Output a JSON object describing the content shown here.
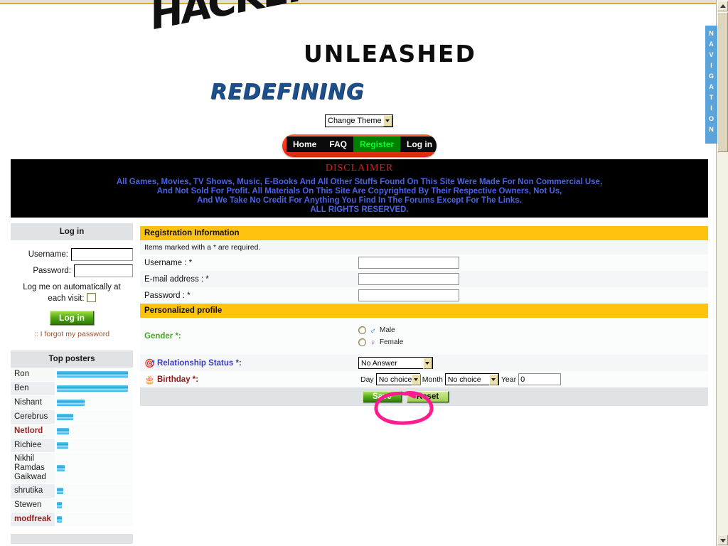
{
  "site": {
    "logo_line1": "HACKERS",
    "logo_line2": "UNLEASHED",
    "logo_line3": "REDEFINING",
    "nav_tab_label": "NAVIGATION"
  },
  "theme": {
    "selected": "Change Theme"
  },
  "mainnav": {
    "items": [
      {
        "label": "Home",
        "active": false
      },
      {
        "label": "FAQ",
        "active": false
      },
      {
        "label": "Register",
        "active": true
      },
      {
        "label": "Log in",
        "active": false
      }
    ]
  },
  "disclaimer": {
    "title": "DISCLAIMER",
    "line1": "All Games, Movies, TV Shows, Music, E-Books And All Other Stuffs Found On This Site Were Made For Non Commercial Use,",
    "line2": "And Not Sold For Profit. All Materials On This Site Are Copyrighted By Their Respective Owners, Not Us,",
    "line3": "And We Take No Credit For Anything You Find In The Forums Except For The Links.",
    "line4": "ALL RIGHTS RESERVED.",
    "title_color": "#d42020",
    "text_color": "#4a62e8"
  },
  "login_panel": {
    "title": "Log in",
    "username_label": "Username:",
    "username_value": "",
    "username_placeholder": "",
    "password_label": "Password:",
    "password_value": "",
    "password_placeholder": "",
    "auto_login_label": "Log me on automatically at each visit:",
    "auto_login_checked": false,
    "login_button": "Log in",
    "forgot_link": ":: I forgot my password"
  },
  "top_posters": {
    "title": "Top posters",
    "rows": [
      {
        "name": "Ron",
        "bar_pct": 100,
        "highlight": false
      },
      {
        "name": "Ben",
        "bar_pct": 100,
        "highlight": false
      },
      {
        "name": "Nishant",
        "bar_pct": 39,
        "highlight": false
      },
      {
        "name": "Cerebrus",
        "bar_pct": 23,
        "highlight": false
      },
      {
        "name": "Netlord",
        "bar_pct": 17,
        "highlight": true
      },
      {
        "name": "Richiee",
        "bar_pct": 16,
        "highlight": false
      },
      {
        "name": "Nikhil Ramdas Gaikwad",
        "bar_pct": 11,
        "highlight": false
      },
      {
        "name": "shrutika",
        "bar_pct": 9,
        "highlight": false
      },
      {
        "name": "Stewen",
        "bar_pct": 7,
        "highlight": false
      },
      {
        "name": "modfreak",
        "bar_pct": 7,
        "highlight": true
      }
    ]
  },
  "registration": {
    "section_title": "Registration Information",
    "required_note": "Items marked with a * are required.",
    "fields": [
      {
        "label": "Username : *",
        "value": "",
        "placeholder": ""
      },
      {
        "label": "E-mail address : *",
        "value": "",
        "placeholder": ""
      },
      {
        "label": "Password : *",
        "value": "",
        "placeholder": ""
      }
    ]
  },
  "profile": {
    "section_title": "Personalized profile",
    "gender": {
      "label": "Gender *:",
      "label_color": "#4ba32a",
      "options": [
        {
          "label": "Male",
          "symbol": "♂",
          "selected": false
        },
        {
          "label": "Female",
          "symbol": "♀",
          "selected": false
        }
      ]
    },
    "relationship": {
      "label": "Relationship Status *:",
      "label_color": "#3b3bbd",
      "icon": "target-icon",
      "selected": "No Answer"
    },
    "birthday": {
      "label": "Birthday *:",
      "label_color": "#8b1a1a",
      "icon": "cake-icon",
      "day_label": "Day",
      "day_value": "No choice",
      "month_label": "Month",
      "month_value": "No choice",
      "year_label": "Year",
      "year_value": "0"
    }
  },
  "form_buttons": {
    "save": "Save",
    "reset": "Reset"
  },
  "annotation": {
    "shape": "hand-drawn-pink-ellipse",
    "color": "#ff1e8e",
    "targets": "save-button"
  },
  "colors": {
    "section_header": "#ffc20e",
    "panel_header": "#dfe3e6",
    "nav_tab": "#5ba3db",
    "nav_active": "#008000"
  }
}
